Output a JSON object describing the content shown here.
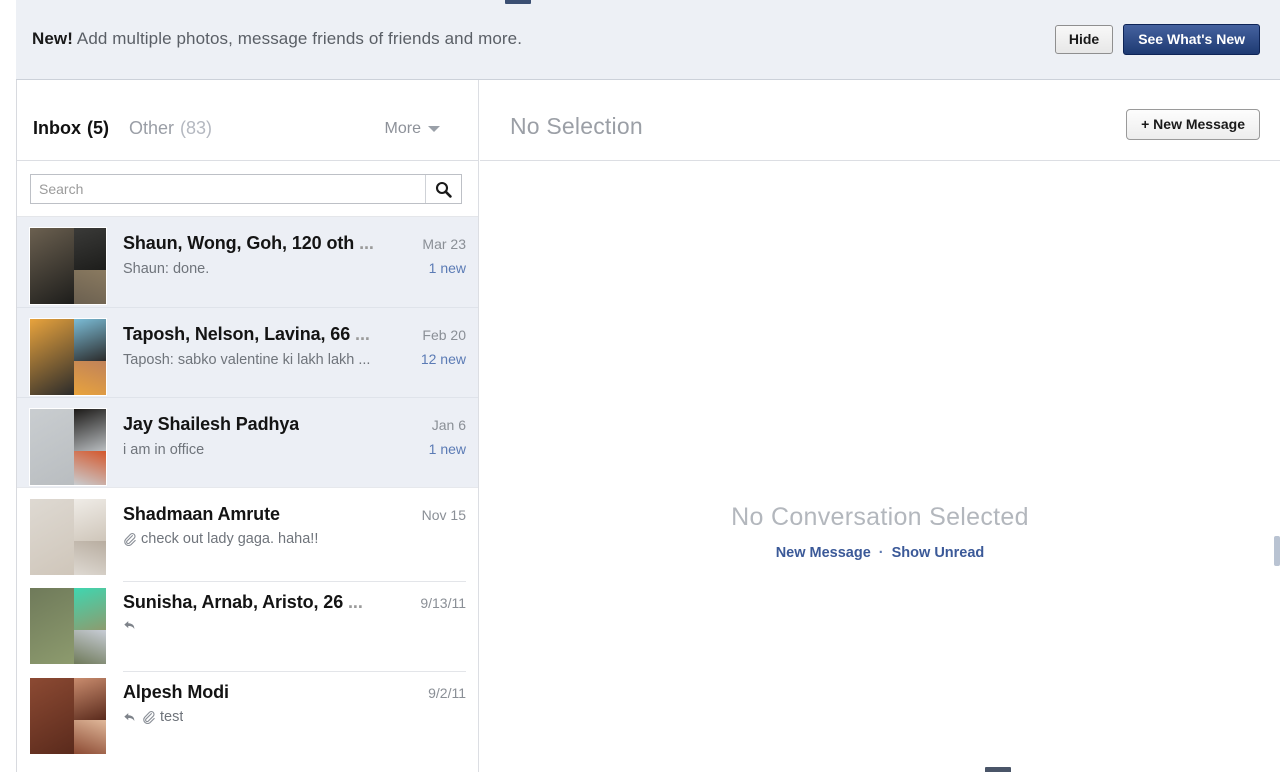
{
  "promo": {
    "badge": "New!",
    "text": "Add multiple photos, message friends of friends and more.",
    "hide_label": "Hide",
    "cta_label": "See What's New"
  },
  "folders": {
    "tabs": [
      {
        "label": "Inbox",
        "count": "(5)",
        "active": true
      },
      {
        "label": "Other",
        "count": "(83)",
        "active": false
      }
    ],
    "more_label": "More"
  },
  "detail_header": {
    "title": "No Selection",
    "new_message_label": "+ New Message"
  },
  "search": {
    "placeholder": "Search",
    "value": "",
    "icon": "search-icon"
  },
  "conversations": [
    {
      "names": "Shaun, Wong, Goh, 120 oth",
      "truncated": true,
      "date": "Mar 23",
      "snippet": "Shaun: done.",
      "snippet_truncated": false,
      "new_count": "1 new",
      "unread": true,
      "has_attachment": false,
      "has_reply": false,
      "avatar_colors": [
        "#6b6050",
        "#3a3a38",
        "#1d1d1b",
        "#8a7a60"
      ]
    },
    {
      "names": "Taposh, Nelson, Lavina, 66",
      "truncated": true,
      "date": "Feb 20",
      "snippet": "Taposh: sabko valentine ki lakh lakh",
      "snippet_truncated": true,
      "new_count": "12 new",
      "unread": true,
      "has_attachment": false,
      "has_reply": false,
      "avatar_colors": [
        "#e8a33d",
        "#7bbcd6",
        "#2b2b2b",
        "#c0825a"
      ]
    },
    {
      "names": "Jay Shailesh Padhya",
      "truncated": false,
      "date": "Jan 6",
      "snippet": "i am in office",
      "snippet_truncated": false,
      "new_count": "1 new",
      "unread": true,
      "has_attachment": false,
      "has_reply": false,
      "avatar_colors": [
        "#c9cdd0",
        "#1c1a18",
        "#b9bdc0",
        "#d4572c"
      ]
    },
    {
      "names": "Shadmaan Amrute",
      "truncated": false,
      "date": "Nov 15",
      "snippet": "check out lady gaga. haha!!",
      "snippet_truncated": false,
      "new_count": "",
      "unread": false,
      "has_attachment": true,
      "has_reply": false,
      "avatar_colors": [
        "#ded9d2",
        "#efece7",
        "#cfc6ba",
        "#b8ada0"
      ]
    },
    {
      "names": "Sunisha, Arnab, Aristo, 26",
      "truncated": true,
      "date": "9/13/11",
      "snippet": "",
      "snippet_truncated": false,
      "new_count": "",
      "unread": false,
      "has_attachment": false,
      "has_reply": true,
      "avatar_colors": [
        "#6f7a5a",
        "#3fd6b0",
        "#8d9b6e",
        "#c8cdd6"
      ]
    },
    {
      "names": "Alpesh Modi",
      "truncated": false,
      "date": "9/2/11",
      "snippet": "test",
      "snippet_truncated": false,
      "new_count": "",
      "unread": false,
      "has_attachment": true,
      "has_reply": true,
      "avatar_colors": [
        "#8c4a33",
        "#c98c6e",
        "#5a2a1c",
        "#e0b89a"
      ]
    }
  ],
  "empty_state": {
    "title": "No Conversation Selected",
    "link_new_message": "New Message",
    "separator": "·",
    "link_show_unread": "Show Unread"
  },
  "colors": {
    "accent": "#3b5998",
    "promo_bg": "#edf0f5",
    "unread_bg": "#eceff5",
    "muted_text": "#9b9fa6"
  }
}
